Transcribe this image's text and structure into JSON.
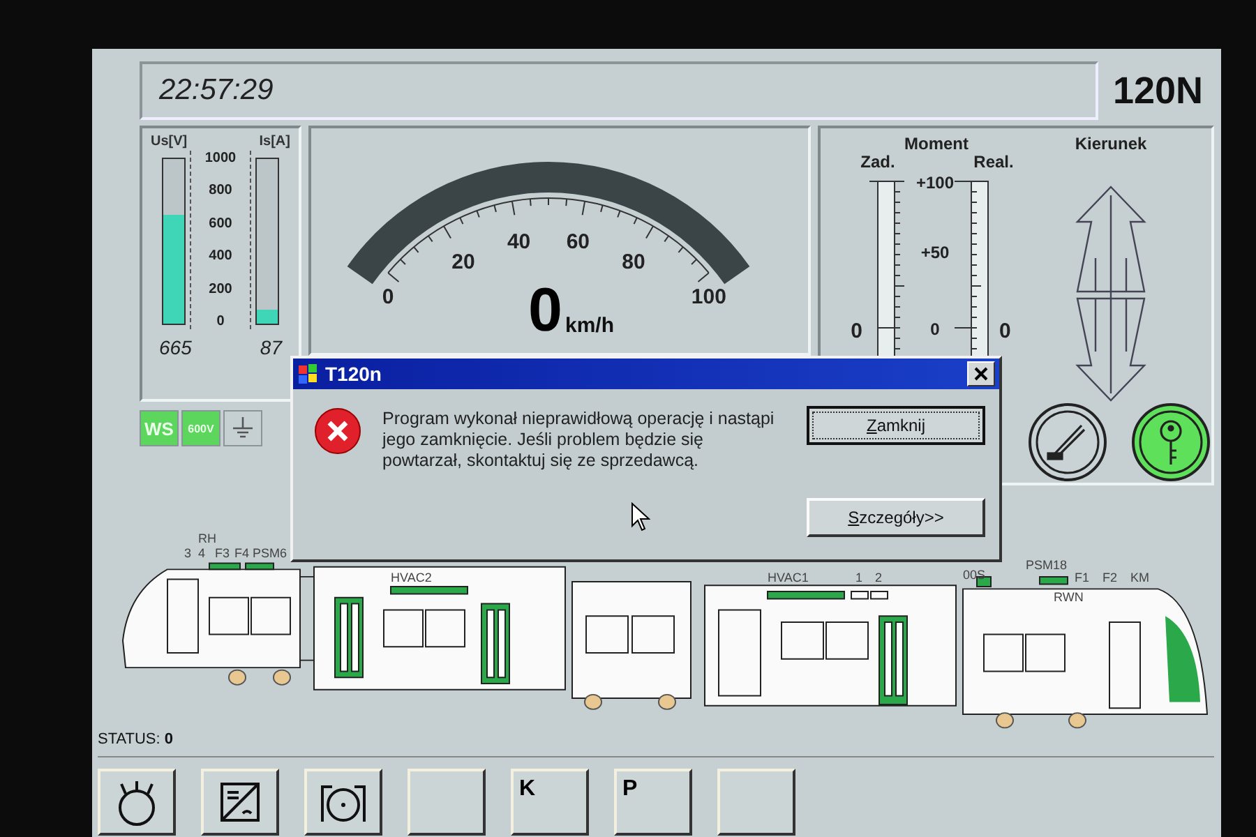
{
  "header": {
    "time": "22:57:29",
    "vehicle": "120N"
  },
  "supply": {
    "bars": [
      {
        "label": "Us[V]",
        "level": 0.665,
        "reading": "665"
      },
      {
        "label": "Is[A]",
        "level": 0.087,
        "reading": "87"
      }
    ],
    "scale": [
      "1000",
      "800",
      "600",
      "400",
      "200",
      "0"
    ]
  },
  "indicators": [
    {
      "kind": "text",
      "label": "WS",
      "on": true
    },
    {
      "kind": "text",
      "label": "600V",
      "on": true
    },
    {
      "kind": "ground",
      "on": false
    }
  ],
  "speed": {
    "ticks": [
      "0",
      "20",
      "40",
      "60",
      "80",
      "100"
    ],
    "level": 0,
    "reading": "0",
    "unit": "km/h"
  },
  "moment": {
    "title": "Moment",
    "scales": [
      {
        "label": "Zad.",
        "zero": "0"
      },
      {
        "label": "Real.",
        "zero": "0"
      }
    ],
    "ticks": [
      "+100",
      "+50",
      "0"
    ]
  },
  "direction": {
    "title": "Kierunek"
  },
  "mode_buttons": [
    {
      "kind": "pantograph",
      "active": false
    },
    {
      "kind": "key",
      "active": true
    }
  ],
  "tram": {
    "labels": [
      "RH",
      "3",
      "4",
      "F3",
      "F4",
      "PSM6",
      "HVAC2",
      "HVAC1",
      "1",
      "2",
      "00S",
      "PSM18",
      "F1",
      "F2",
      "KM",
      "RWN"
    ],
    "status_label": "STATUS:",
    "status": "0"
  },
  "toolbar": [
    {
      "kind": "motor"
    },
    {
      "kind": "converter"
    },
    {
      "kind": "brake"
    },
    {
      "kind": "blank"
    },
    {
      "kind": "text",
      "label": "K"
    },
    {
      "kind": "text",
      "label": "P"
    },
    {
      "kind": "blank"
    }
  ],
  "dialog": {
    "title": "T120n",
    "message": "Program wykonał nieprawidłową operację i nastąpi jego zamknięcie. Jeśli problem będzie się powtarzał, skontaktuj się ze sprzedawcą.",
    "buttons": [
      {
        "label": "Zamknij",
        "focused": true
      },
      {
        "label": "Szczegóły>>",
        "focused": false
      }
    ]
  }
}
